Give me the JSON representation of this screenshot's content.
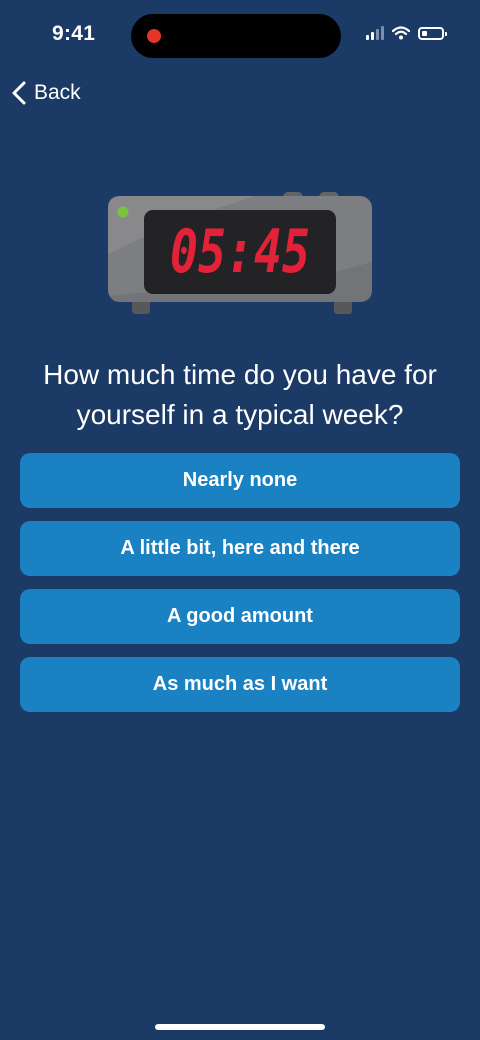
{
  "status_bar": {
    "time": "9:41",
    "signal_bars": 2,
    "battery_level": 0.3,
    "icons": [
      "cellular-signal-icon",
      "wifi-icon",
      "battery-icon"
    ]
  },
  "nav": {
    "back_label": "Back",
    "icon": "chevron-left-icon"
  },
  "illustration": {
    "name": "alarm-clock",
    "display_time": "05:45",
    "display_color": "#e3223a",
    "light_color": "#7bc142"
  },
  "question": {
    "line1": "How much time do you have for",
    "line2": "yourself in a typical week?"
  },
  "options": [
    {
      "label": "Nearly none"
    },
    {
      "label": "A little bit, here and there"
    },
    {
      "label": "A good amount"
    },
    {
      "label": "As much as I want"
    }
  ],
  "colors": {
    "background": "#1c3a66",
    "button": "#1a81c2",
    "text": "#ffffff"
  }
}
